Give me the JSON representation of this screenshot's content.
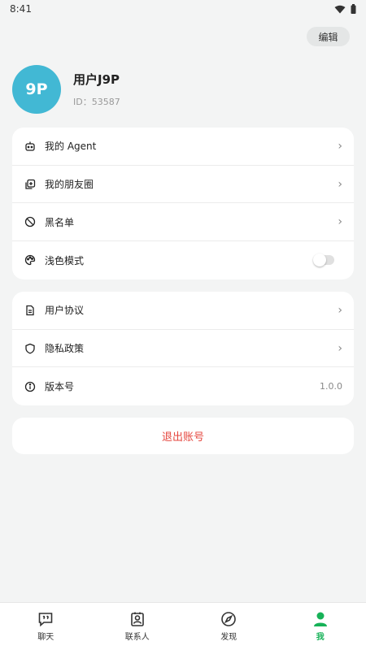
{
  "status": {
    "time": "8:41"
  },
  "header": {
    "edit_label": "编辑"
  },
  "profile": {
    "avatar_text": "9P",
    "name": "用户J9P",
    "id_text": "ID：53587",
    "avatar_color": "#42b8d4"
  },
  "menu1": [
    {
      "label": "我的 Agent",
      "icon": "robot-icon"
    },
    {
      "label": "我的朋友圈",
      "icon": "moments-icon"
    },
    {
      "label": "黑名单",
      "icon": "block-icon"
    },
    {
      "label": "浅色模式",
      "icon": "palette-icon",
      "toggle": false
    }
  ],
  "menu2": [
    {
      "label": "用户协议",
      "icon": "document-icon"
    },
    {
      "label": "隐私政策",
      "icon": "shield-icon"
    },
    {
      "label": "版本号",
      "icon": "info-icon",
      "value": "1.0.0"
    }
  ],
  "logout_label": "退出账号",
  "nav": [
    {
      "label": "聊天",
      "icon": "chat-icon"
    },
    {
      "label": "联系人",
      "icon": "contacts-icon"
    },
    {
      "label": "发现",
      "icon": "compass-icon"
    },
    {
      "label": "我",
      "icon": "person-icon",
      "active": true
    }
  ],
  "colors": {
    "accent": "#17b258",
    "danger": "#e5473f",
    "background": "#f3f4f4"
  }
}
